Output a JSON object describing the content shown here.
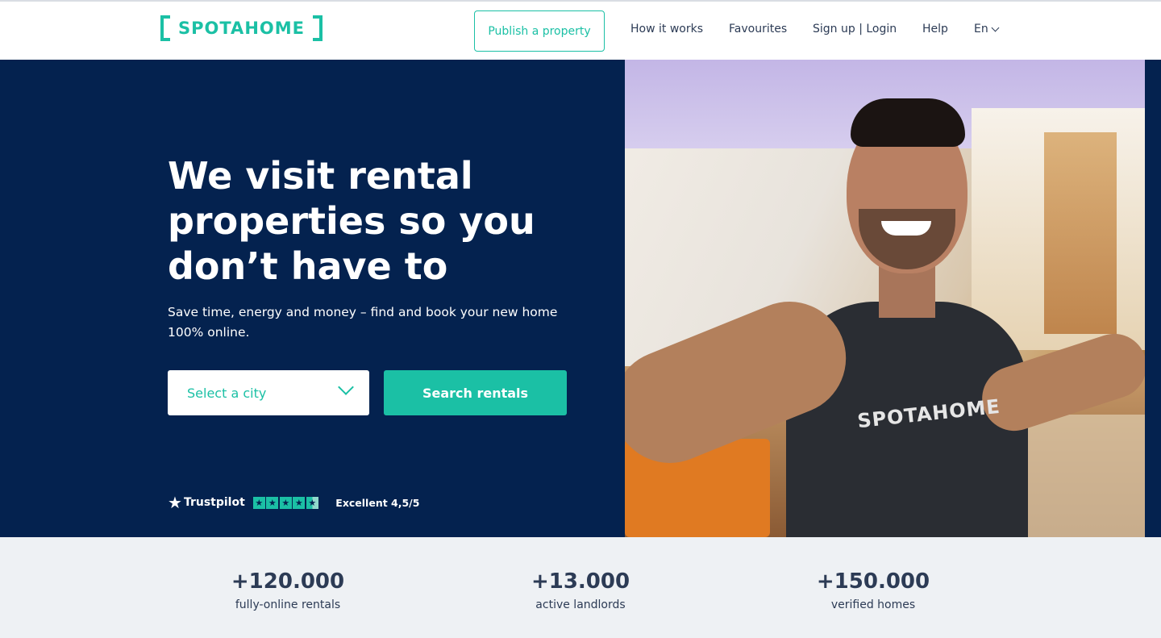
{
  "header": {
    "logo_text": "SPOTAHOME",
    "publish_label": "Publish a property",
    "nav": {
      "how": "How it works",
      "favourites": "Favourites",
      "signup": "Sign up | Login",
      "help": "Help",
      "language": "En"
    }
  },
  "hero": {
    "title": "We visit rental properties so you don’t have to",
    "subtitle": "Save time, energy and money – find and book your new home 100% online.",
    "city_placeholder": "Select a city",
    "search_label": "Search rentals",
    "trustpilot": {
      "brand": "Trustpilot",
      "rating_text": "Excellent 4,5/5",
      "stars": 4.5
    },
    "shirt_text": "SPOTAHOME"
  },
  "stats": [
    {
      "value": "+120.000",
      "label": "fully-online rentals"
    },
    {
      "value": "+13.000",
      "label": "active landlords"
    },
    {
      "value": "+150.000",
      "label": "verified homes"
    }
  ],
  "colors": {
    "brand": "#1bc0a5",
    "hero_bg": "#04224f",
    "stats_bg": "#eef1f4"
  }
}
